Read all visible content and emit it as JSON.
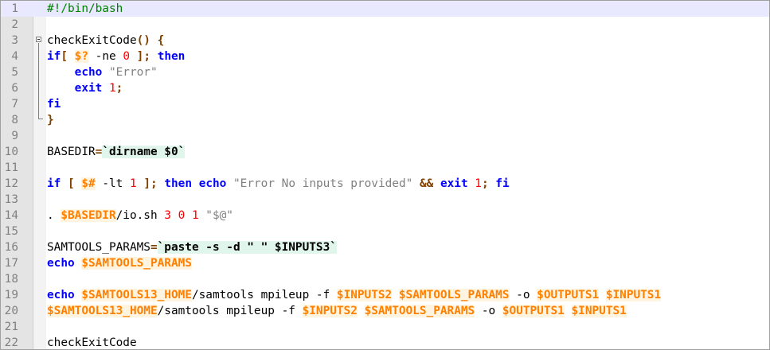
{
  "editor": {
    "lines": [
      {
        "n": "1",
        "cur": true,
        "t": [
          [
            "cm",
            "#!/bin/bash"
          ]
        ]
      },
      {
        "n": "2",
        "t": []
      },
      {
        "n": "3",
        "t": [
          [
            "",
            "checkExitCode"
          ],
          [
            "br",
            "() {"
          ]
        ]
      },
      {
        "n": "4",
        "t": [
          [
            "kw",
            "if"
          ],
          [
            "",
            "",
            " "
          ],
          [
            "br",
            "["
          ],
          [
            "",
            " "
          ],
          [
            "var",
            "$?"
          ],
          [
            "",
            " -ne "
          ],
          [
            "num",
            "0"
          ],
          [
            "",
            " "
          ],
          [
            "br",
            "]"
          ],
          [
            "op",
            ";"
          ],
          [
            "",
            " "
          ],
          [
            "kw",
            "then"
          ]
        ]
      },
      {
        "n": "5",
        "t": [
          [
            "",
            "    "
          ],
          [
            "kw",
            "echo"
          ],
          [
            "",
            " "
          ],
          [
            "str",
            "\"Error\""
          ]
        ]
      },
      {
        "n": "6",
        "t": [
          [
            "",
            "    "
          ],
          [
            "kw",
            "exit"
          ],
          [
            "",
            " "
          ],
          [
            "num",
            "1"
          ],
          [
            "op",
            ";"
          ]
        ]
      },
      {
        "n": "7",
        "t": [
          [
            "kw",
            "fi"
          ]
        ]
      },
      {
        "n": "8",
        "t": [
          [
            "br",
            "}"
          ]
        ]
      },
      {
        "n": "9",
        "t": []
      },
      {
        "n": "10",
        "t": [
          [
            "",
            "BASEDIR"
          ],
          [
            "op",
            "="
          ],
          [
            "bt",
            "`dirname $0`"
          ]
        ]
      },
      {
        "n": "11",
        "t": []
      },
      {
        "n": "12",
        "t": [
          [
            "kw",
            "if"
          ],
          [
            "",
            " "
          ],
          [
            "br",
            "["
          ],
          [
            "",
            " "
          ],
          [
            "var",
            "$#"
          ],
          [
            "",
            " -lt "
          ],
          [
            "num",
            "1"
          ],
          [
            "",
            " "
          ],
          [
            "br",
            "]"
          ],
          [
            "op",
            ";"
          ],
          [
            "",
            " "
          ],
          [
            "kw",
            "then"
          ],
          [
            "",
            " "
          ],
          [
            "kw",
            "echo"
          ],
          [
            "",
            " "
          ],
          [
            "str",
            "\"Error No inputs provided\""
          ],
          [
            "",
            " "
          ],
          [
            "op",
            "&&"
          ],
          [
            "",
            " "
          ],
          [
            "kw",
            "exit"
          ],
          [
            "",
            " "
          ],
          [
            "num",
            "1"
          ],
          [
            "op",
            ";"
          ],
          [
            "",
            " "
          ],
          [
            "kw",
            "fi"
          ]
        ]
      },
      {
        "n": "13",
        "t": []
      },
      {
        "n": "14",
        "t": [
          [
            "",
            ". "
          ],
          [
            "var",
            "$BASEDIR"
          ],
          [
            "",
            "/io.sh "
          ],
          [
            "num",
            "3 0 1"
          ],
          [
            "",
            " "
          ],
          [
            "str",
            "\"$@\""
          ]
        ]
      },
      {
        "n": "15",
        "t": []
      },
      {
        "n": "16",
        "t": [
          [
            "",
            "SAMTOOLS_PARAMS"
          ],
          [
            "op",
            "="
          ],
          [
            "bt",
            "`paste -s -d \" \" $INPUTS3`"
          ]
        ]
      },
      {
        "n": "17",
        "t": [
          [
            "kw",
            "echo"
          ],
          [
            "",
            " "
          ],
          [
            "var",
            "$SAMTOOLS_PARAMS"
          ]
        ]
      },
      {
        "n": "18",
        "t": []
      },
      {
        "n": "19",
        "t": [
          [
            "kw",
            "echo"
          ],
          [
            "",
            " "
          ],
          [
            "var",
            "$SAMTOOLS13_HOME"
          ],
          [
            "",
            "/samtools mpileup -f "
          ],
          [
            "var",
            "$INPUTS2"
          ],
          [
            "",
            " "
          ],
          [
            "var",
            "$SAMTOOLS_PARAMS"
          ],
          [
            "",
            " -o "
          ],
          [
            "var",
            "$OUTPUTS1"
          ],
          [
            "",
            " "
          ],
          [
            "var",
            "$INPUTS1"
          ]
        ]
      },
      {
        "n": "20",
        "t": [
          [
            "var",
            "$SAMTOOLS13_HOME"
          ],
          [
            "",
            "/samtools mpileup -f "
          ],
          [
            "var",
            "$INPUTS2"
          ],
          [
            "",
            " "
          ],
          [
            "var",
            "$SAMTOOLS_PARAMS"
          ],
          [
            "",
            " -o "
          ],
          [
            "var",
            "$OUTPUTS1"
          ],
          [
            "",
            " "
          ],
          [
            "var",
            "$INPUTS1"
          ]
        ]
      },
      {
        "n": "21",
        "t": []
      },
      {
        "n": "22",
        "t": [
          [
            "",
            "checkExitCode"
          ]
        ]
      }
    ]
  }
}
